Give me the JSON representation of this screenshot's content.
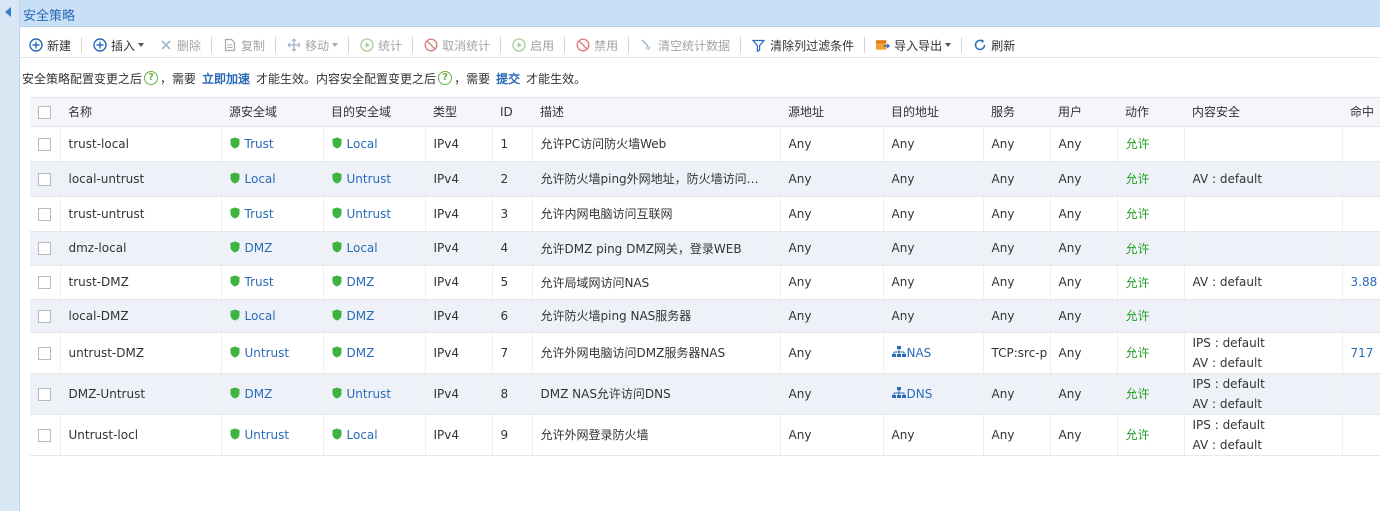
{
  "window": {
    "title": "安全策略"
  },
  "toolbar": {
    "new": "新建",
    "insert": "插入",
    "delete": "删除",
    "copy": "复制",
    "move": "移动",
    "stats": "统计",
    "cancel_stats": "取消统计",
    "enable": "启用",
    "disable": "禁用",
    "clear_stats": "清空统计数据",
    "clear_filter": "清除列过滤条件",
    "import_export": "导入导出",
    "refresh": "刷新"
  },
  "notice": {
    "part1": "安全策略配置变更之后",
    "part2": "，需要",
    "link1": "立即加速",
    "part3": "才能生效。内容安全配置变更之后",
    "part4": "，需要",
    "link2": "提交",
    "part5": "才能生效。",
    "help_glyph": "?"
  },
  "table": {
    "columns": {
      "name": "名称",
      "src_zone": "源安全域",
      "dst_zone": "目的安全域",
      "type": "类型",
      "id": "ID",
      "desc": "描述",
      "src_addr": "源地址",
      "dst_addr": "目的地址",
      "service": "服务",
      "user": "用户",
      "action": "动作",
      "content_security": "内容安全",
      "hit": "命中"
    },
    "rows": [
      {
        "name": "trust-local",
        "src_zone": "Trust",
        "dst_zone": "Local",
        "type": "IPv4",
        "id": "1",
        "desc": "允许PC访问防火墙Web",
        "src_addr": "Any",
        "dst_addr": "Any",
        "service": "Any",
        "user": "Any",
        "action": "允许",
        "cs1": "",
        "cs2": "",
        "hit": ""
      },
      {
        "name": "local-untrust",
        "src_zone": "Local",
        "dst_zone": "Untrust",
        "type": "IPv4",
        "id": "2",
        "desc": "允许防火墙ping外网地址，防火墙访问…",
        "src_addr": "Any",
        "dst_addr": "Any",
        "service": "Any",
        "user": "Any",
        "action": "允许",
        "cs1": "AV : default",
        "cs2": "",
        "hit": ""
      },
      {
        "name": "trust-untrust",
        "src_zone": "Trust",
        "dst_zone": "Untrust",
        "type": "IPv4",
        "id": "3",
        "desc": "允许内网电脑访问互联网",
        "src_addr": "Any",
        "dst_addr": "Any",
        "service": "Any",
        "user": "Any",
        "action": "允许",
        "cs1": "",
        "cs2": "",
        "hit": ""
      },
      {
        "name": "dmz-local",
        "src_zone": "DMZ",
        "dst_zone": "Local",
        "type": "IPv4",
        "id": "4",
        "desc": "允许DMZ ping DMZ网关，登录WEB",
        "src_addr": "Any",
        "dst_addr": "Any",
        "service": "Any",
        "user": "Any",
        "action": "允许",
        "cs1": "",
        "cs2": "",
        "hit": ""
      },
      {
        "name": "trust-DMZ",
        "src_zone": "Trust",
        "dst_zone": "DMZ",
        "type": "IPv4",
        "id": "5",
        "desc": "允许局域网访问NAS",
        "src_addr": "Any",
        "dst_addr": "Any",
        "service": "Any",
        "user": "Any",
        "action": "允许",
        "cs1": "AV : default",
        "cs2": "",
        "hit": "3.88"
      },
      {
        "name": "local-DMZ",
        "src_zone": "Local",
        "dst_zone": "DMZ",
        "type": "IPv4",
        "id": "6",
        "desc": "允许防火墙ping NAS服务器",
        "src_addr": "Any",
        "dst_addr": "Any",
        "service": "Any",
        "user": "Any",
        "action": "允许",
        "cs1": "",
        "cs2": "",
        "hit": ""
      },
      {
        "name": "untrust-DMZ",
        "src_zone": "Untrust",
        "dst_zone": "DMZ",
        "type": "IPv4",
        "id": "7",
        "desc": "允许外网电脑访问DMZ服务器NAS",
        "src_addr": "Any",
        "dst_addr": "NAS",
        "service": "TCP:src-p",
        "user": "Any",
        "action": "允许",
        "cs1": "IPS : default",
        "cs2": "AV : default",
        "hit": "717"
      },
      {
        "name": "DMZ-Untrust",
        "src_zone": "DMZ",
        "dst_zone": "Untrust",
        "type": "IPv4",
        "id": "8",
        "desc": "DMZ NAS允许访问DNS",
        "src_addr": "Any",
        "dst_addr": "DNS",
        "service": "Any",
        "user": "Any",
        "action": "允许",
        "cs1": "IPS : default",
        "cs2": "AV : default",
        "hit": ""
      },
      {
        "name": "Untrust-locl",
        "src_zone": "Untrust",
        "dst_zone": "Local",
        "type": "IPv4",
        "id": "9",
        "desc": "允许外网登录防火墙",
        "src_addr": "Any",
        "dst_addr": "Any",
        "service": "Any",
        "user": "Any",
        "action": "允许",
        "cs1": "IPS : default",
        "cs2": "AV : default",
        "hit": ""
      }
    ]
  },
  "colors": {
    "accent": "#2a6bb8",
    "allow": "#25a025",
    "shield": "#3fb33f",
    "row_alt": "#eef2f8"
  },
  "icons": [
    "plus-circle-icon",
    "close-x-icon",
    "document-icon",
    "move-arrows-icon",
    "play-circle-icon",
    "no-entry-icon",
    "broom-icon",
    "filter-icon",
    "import-export-icon",
    "refresh-icon",
    "shield-icon",
    "network-icon",
    "help-icon"
  ]
}
